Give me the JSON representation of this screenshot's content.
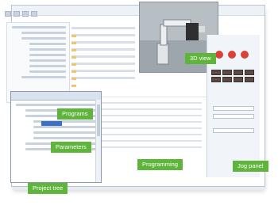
{
  "labels": {
    "view3d": "3D view",
    "programs": "Programs",
    "parameters": "Parameters",
    "programming": "Programming",
    "jog_panel": "Jog panel",
    "project_tree": "Project tree"
  },
  "colors": {
    "label_bg": "#5fb43b",
    "jog_button": "#5a4b47",
    "selection": "#3b6fc4"
  }
}
